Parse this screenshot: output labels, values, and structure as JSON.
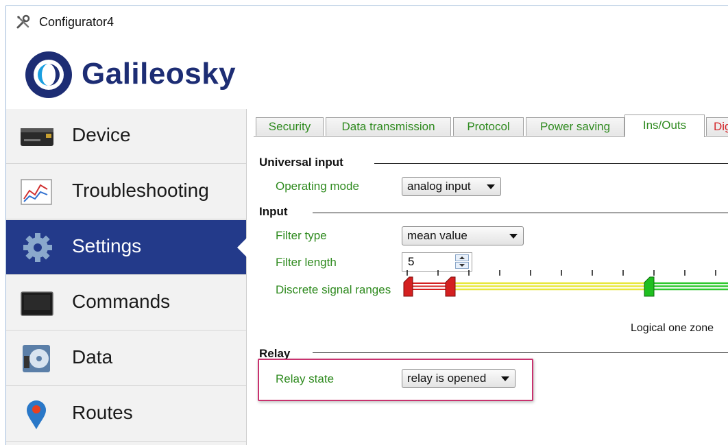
{
  "window": {
    "title": "Configurator4"
  },
  "brand": {
    "name": "Galileosky",
    "color": "#1d2d74"
  },
  "sidebar": {
    "active_color": "#233a8a",
    "items": [
      {
        "label": "Device",
        "icon": "device-icon"
      },
      {
        "label": "Troubleshooting",
        "icon": "chart-icon"
      },
      {
        "label": "Settings",
        "icon": "gear-icon",
        "active": true
      },
      {
        "label": "Commands",
        "icon": "terminal-icon"
      },
      {
        "label": "Data",
        "icon": "disk-icon"
      },
      {
        "label": "Routes",
        "icon": "map-pin-icon"
      }
    ]
  },
  "tabs": [
    {
      "label": "Security"
    },
    {
      "label": "Data transmission"
    },
    {
      "label": "Protocol"
    },
    {
      "label": "Power saving"
    },
    {
      "label": "Ins/Outs",
      "active": true
    },
    {
      "label": "Dig"
    }
  ],
  "sections": {
    "universal_input": {
      "title": "Universal input",
      "operating_mode_label": "Operating mode",
      "operating_mode_value": "analog input"
    },
    "input": {
      "title": "Input",
      "filter_type_label": "Filter type",
      "filter_type_value": "mean value",
      "filter_length_label": "Filter length",
      "filter_length_value": "5",
      "discrete_ranges_label": "Discrete signal ranges",
      "logical_one_label": "Logical one zone"
    },
    "relay": {
      "title": "Relay",
      "relay_state_label": "Relay state",
      "relay_state_value": "relay is opened"
    }
  },
  "colors": {
    "label_green": "#2e8a1e",
    "zone_red": "#d42020",
    "zone_yellow": "#e8e83a",
    "zone_green": "#2ec82e",
    "highlight": "#c8326e"
  }
}
